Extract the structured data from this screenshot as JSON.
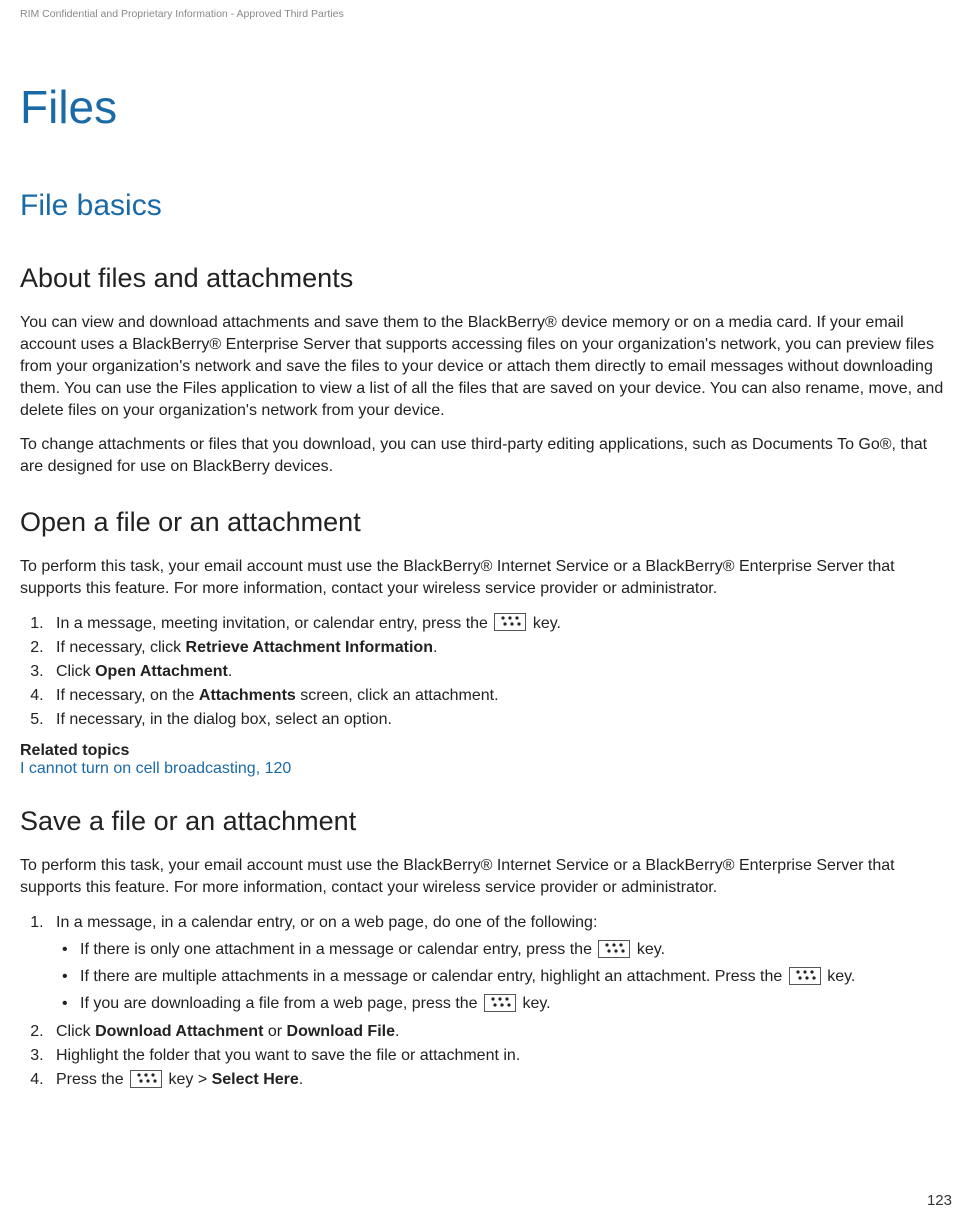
{
  "header": "RIM Confidential and Proprietary Information - Approved Third Parties",
  "title": "Files",
  "section": "File basics",
  "sub1": {
    "heading": "About files and attachments",
    "para1": "You can view and download attachments and save them to the BlackBerry® device memory or on a media card. If your email account uses a BlackBerry® Enterprise Server that supports accessing files on your organization's network, you can preview files from your organization's network and save the files to your device or attach them directly to email messages without downloading them. You can use the Files application to view a list of all the files that are saved on your device. You can also rename, move, and delete files on your organization's network from your device.",
    "para2": "To change attachments or files that you download, you can use third-party editing applications, such as Documents To Go®, that are designed for use on BlackBerry devices."
  },
  "sub2": {
    "heading": "Open a file or an attachment",
    "intro": "To perform this task, your email account must use the BlackBerry® Internet Service or a BlackBerry® Enterprise Server that supports this feature. For more information, contact your wireless service provider or administrator.",
    "step1_prefix": "In a message, meeting invitation, or calendar entry, press the ",
    "step1_suffix": " key.",
    "step2_prefix": "If necessary, click ",
    "step2_bold": "Retrieve Attachment Information",
    "step2_suffix": ".",
    "step3_prefix": "Click ",
    "step3_bold": "Open Attachment",
    "step3_suffix": ".",
    "step4_prefix": "If necessary, on the ",
    "step4_bold": "Attachments",
    "step4_suffix": " screen, click an attachment.",
    "step5": "If necessary, in the dialog box, select an option.",
    "related_heading": "Related topics",
    "related_link": "I cannot turn on cell broadcasting, 120"
  },
  "sub3": {
    "heading": "Save a file or an attachment",
    "intro": "To perform this task, your email account must use the BlackBerry® Internet Service or a BlackBerry® Enterprise Server that supports this feature. For more information, contact your wireless service provider or administrator.",
    "step1": "In a message, in a calendar entry, or on a web page, do one of the following:",
    "bullet1_prefix": "If there is only one attachment in a message or calendar entry, press the ",
    "bullet1_suffix": " key.",
    "bullet2_prefix": "If there are multiple attachments in a message or calendar entry, highlight an attachment. Press the ",
    "bullet2_suffix": " key.",
    "bullet3_prefix": "If you are downloading a file from a web page, press the ",
    "bullet3_suffix": " key.",
    "step2_prefix": "Click ",
    "step2_bold1": "Download Attachment",
    "step2_mid": " or ",
    "step2_bold2": "Download File",
    "step2_suffix": ".",
    "step3": "Highlight the folder that you want to save the file or attachment in.",
    "step4_prefix": "Press the ",
    "step4_mid": " key > ",
    "step4_bold": "Select Here",
    "step4_suffix": "."
  },
  "page_number": "123"
}
